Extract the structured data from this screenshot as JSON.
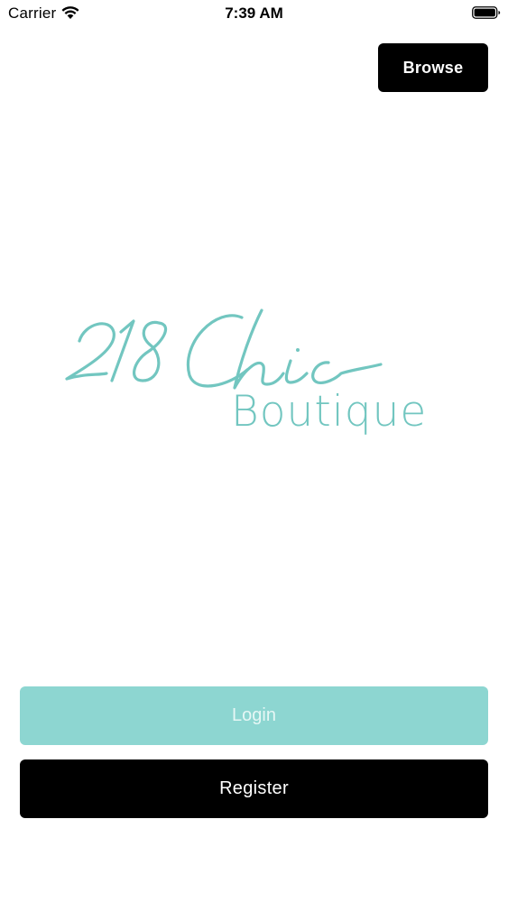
{
  "status_bar": {
    "carrier": "Carrier",
    "time": "7:39 AM",
    "wifi_icon": "wifi-icon",
    "battery_icon": "battery-icon"
  },
  "header": {
    "browse_label": "Browse"
  },
  "logo": {
    "script_text": "218 Chic",
    "subtitle": "Boutique",
    "color": "#72c6c0"
  },
  "actions": {
    "login_label": "Login",
    "register_label": "Register",
    "login_color": "#8dd6d1",
    "register_color": "#000000"
  }
}
